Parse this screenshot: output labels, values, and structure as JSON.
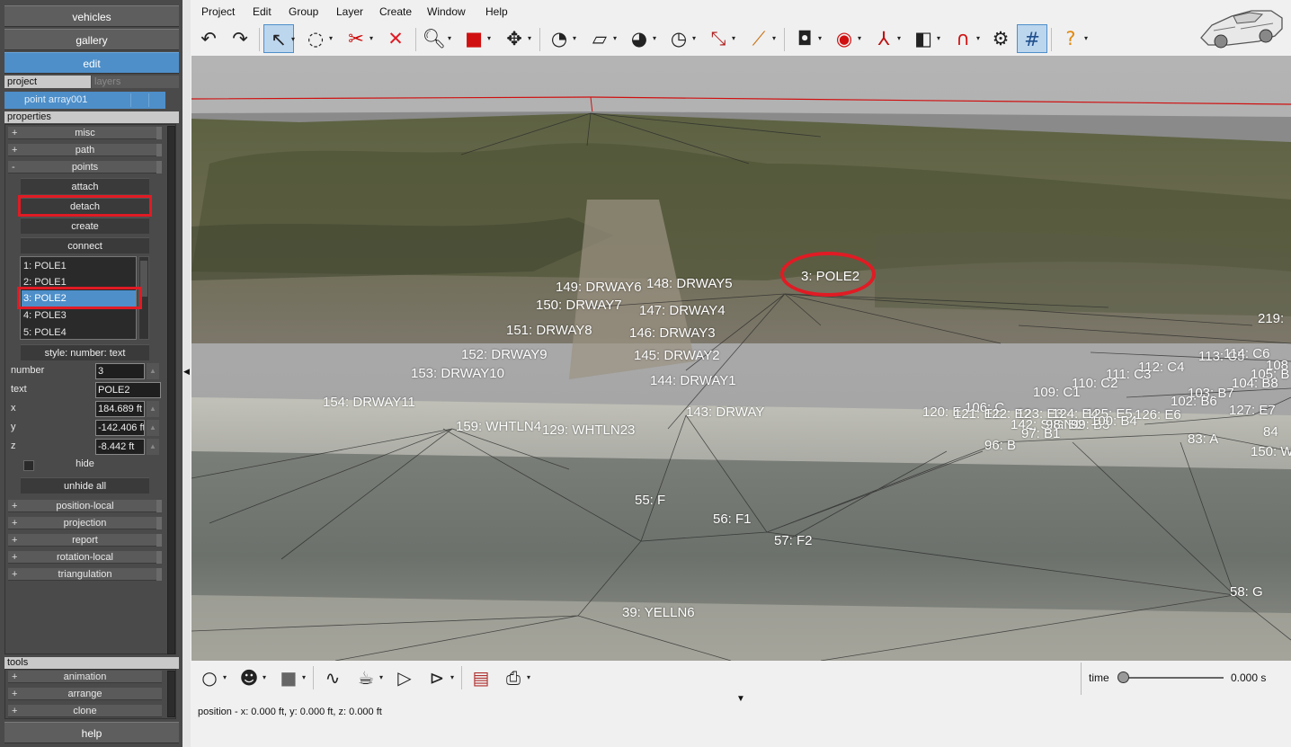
{
  "nav": {
    "vehicles": "vehicles",
    "gallery": "gallery",
    "edit": "edit",
    "help": "help"
  },
  "tabs": {
    "project": "project",
    "layers": "layers"
  },
  "selected_object": "point array001",
  "sections": {
    "properties": "properties",
    "tools": "tools"
  },
  "property_groups": {
    "misc": {
      "label": "misc",
      "toggle": "+"
    },
    "path": {
      "label": "path",
      "toggle": "+"
    },
    "points": {
      "label": "points",
      "toggle": "-"
    },
    "position_local": {
      "label": "position-local",
      "toggle": "+"
    },
    "projection": {
      "label": "projection",
      "toggle": "+"
    },
    "report": {
      "label": "report",
      "toggle": "+"
    },
    "rotation_local": {
      "label": "rotation-local",
      "toggle": "+"
    },
    "triangulation": {
      "label": "triangulation",
      "toggle": "+"
    }
  },
  "points_panel": {
    "attach": "attach",
    "detach": "detach",
    "create": "create",
    "connect": "connect",
    "list": [
      "1: POLE1",
      "2: POLE1",
      "3: POLE2",
      "4: POLE3",
      "5: POLE4"
    ],
    "selected_index": 2,
    "style": "style: number: text",
    "number_label": "number",
    "number_value": "3",
    "text_label": "text",
    "text_value": "POLE2",
    "x_label": "x",
    "x_value": "184.689 ft",
    "y_label": "y",
    "y_value": "-142.406 ft",
    "z_label": "z",
    "z_value": "-8.442 ft",
    "hide": "hide",
    "unhide_all": "unhide all"
  },
  "tool_groups": {
    "animation": {
      "label": "animation",
      "toggle": "+"
    },
    "arrange": {
      "label": "arrange",
      "toggle": "+"
    },
    "clone": {
      "label": "clone",
      "toggle": "+"
    }
  },
  "menu": [
    "Project",
    "Edit",
    "Group",
    "Layer",
    "Create",
    "Window",
    "Help"
  ],
  "icons": {
    "undo": "undo-icon",
    "redo": "redo-icon",
    "select": "select-arrow-icon",
    "lasso": "lasso-icon",
    "delete": "delete-x-icon",
    "zoom": "zoom-icon",
    "box": "box-icon",
    "pan": "pan-icon",
    "measure": "measure-icon",
    "grid": "grid-icon",
    "help": "help-icon"
  },
  "viewport_labels": [
    {
      "id": "lbl-149",
      "text": "149: DRWAY6"
    },
    {
      "id": "lbl-148",
      "text": "148: DRWAY5"
    },
    {
      "id": "lbl-150",
      "text": "150: DRWAY7"
    },
    {
      "id": "lbl-147",
      "text": "147: DRWAY4"
    },
    {
      "id": "lbl-151",
      "text": "151: DRWAY8"
    },
    {
      "id": "lbl-146",
      "text": "146: DRWAY3"
    },
    {
      "id": "lbl-152",
      "text": "152: DRWAY9"
    },
    {
      "id": "lbl-145",
      "text": "145: DRWAY2"
    },
    {
      "id": "lbl-153",
      "text": "153: DRWAY10"
    },
    {
      "id": "lbl-144",
      "text": "144: DRWAY1"
    },
    {
      "id": "lbl-154",
      "text": "154: DRWAY11"
    },
    {
      "id": "lbl-143",
      "text": "143: DRWAY"
    },
    {
      "id": "lbl-159",
      "text": "159: WHTLN4"
    },
    {
      "id": "lbl-129",
      "text": "129: WHTLN23"
    },
    {
      "id": "lbl-3",
      "text": "3: POLE2"
    },
    {
      "id": "lbl-219",
      "text": "219:"
    },
    {
      "id": "lbl-113",
      "text": "113: C5"
    },
    {
      "id": "lbl-114",
      "text": "114: C6"
    },
    {
      "id": "lbl-108",
      "text": "108"
    },
    {
      "id": "lbl-112",
      "text": "112: C4"
    },
    {
      "id": "lbl-105",
      "text": "105: B"
    },
    {
      "id": "lbl-111",
      "text": "111: C3"
    },
    {
      "id": "lbl-104",
      "text": "104: B8"
    },
    {
      "id": "lbl-110",
      "text": "110: C2"
    },
    {
      "id": "lbl-103",
      "text": "103: B7"
    },
    {
      "id": "lbl-109",
      "text": "109: C1"
    },
    {
      "id": "lbl-102",
      "text": "102: B6"
    },
    {
      "id": "lbl-106",
      "text": "106: C"
    },
    {
      "id": "lbl-120",
      "text": "120: E"
    },
    {
      "id": "lbl-121",
      "text": "121: E1"
    },
    {
      "id": "lbl-122",
      "text": "122: E2"
    },
    {
      "id": "lbl-123",
      "text": "123: E3"
    },
    {
      "id": "lbl-124",
      "text": "124: E4"
    },
    {
      "id": "lbl-125",
      "text": "125: E5"
    },
    {
      "id": "lbl-126",
      "text": "126: E6"
    },
    {
      "id": "lbl-127",
      "text": "127: E7"
    },
    {
      "id": "lbl-142",
      "text": "142: SIGN1"
    },
    {
      "id": "lbl-98",
      "text": "98: B2"
    },
    {
      "id": "lbl-99",
      "text": "99: B3"
    },
    {
      "id": "lbl-100",
      "text": "100: B4"
    },
    {
      "id": "lbl-97",
      "text": "97: B1"
    },
    {
      "id": "lbl-96",
      "text": "96: B"
    },
    {
      "id": "lbl-83",
      "text": "83: A"
    },
    {
      "id": "lbl-84",
      "text": "84"
    },
    {
      "id": "lbl-150w",
      "text": "150: W"
    },
    {
      "id": "lbl-55",
      "text": "55: F"
    },
    {
      "id": "lbl-56",
      "text": "56: F1"
    },
    {
      "id": "lbl-57",
      "text": "57: F2"
    },
    {
      "id": "lbl-58",
      "text": "58: G"
    },
    {
      "id": "lbl-39",
      "text": "39: YELLN6"
    }
  ],
  "time": {
    "label": "time",
    "value": "0.000 s",
    "progress": 0
  },
  "status": "position - x: 0.000 ft, y: 0.000 ft, z: 0.000 ft",
  "colors": {
    "accent": "#4e8fc9",
    "highlight": "#e01b24",
    "panel": "#4a4a4a"
  }
}
